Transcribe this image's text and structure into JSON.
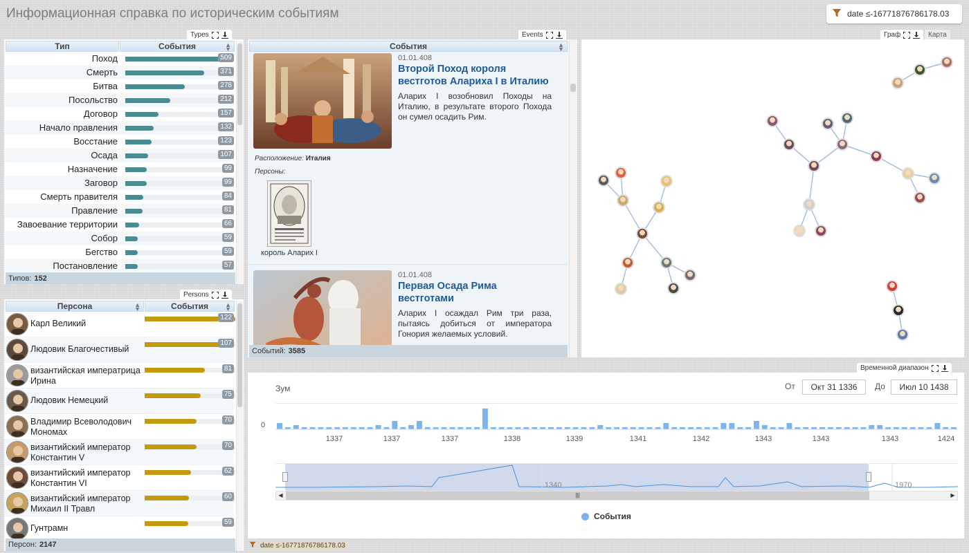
{
  "page": {
    "title": "Информационная справка по историческим событиям"
  },
  "filter": {
    "text": "date ≤-16771876786178.03",
    "icon": "funnel-icon"
  },
  "types_panel": {
    "tab": "Types",
    "col_type": "Тип",
    "col_events": "События",
    "bar_color": "#4a8a93",
    "rows": [
      {
        "label": "Поход",
        "count": "509",
        "value": 509
      },
      {
        "label": "Смерть",
        "count": "371",
        "value": 371
      },
      {
        "label": "Битва",
        "count": "278",
        "value": 278
      },
      {
        "label": "Посольство",
        "count": "212",
        "value": 212
      },
      {
        "label": "Договор",
        "count": "157",
        "value": 157
      },
      {
        "label": "Начало правления",
        "count": "132",
        "value": 132
      },
      {
        "label": "Восстание",
        "count": "123",
        "value": 123
      },
      {
        "label": "Осада",
        "count": "107",
        "value": 107
      },
      {
        "label": "Назначение",
        "count": "99",
        "value": 99
      },
      {
        "label": "Заговор",
        "count": "99",
        "value": 99
      },
      {
        "label": "Смерть правителя",
        "count": "84",
        "value": 84
      },
      {
        "label": "Правление",
        "count": "81",
        "value": 81
      },
      {
        "label": "Завоевание территории",
        "count": "66",
        "value": 66
      },
      {
        "label": "Собор",
        "count": "59",
        "value": 59
      },
      {
        "label": "Бегство",
        "count": "59",
        "value": 59
      },
      {
        "label": "Постановление",
        "count": "57",
        "value": 57
      }
    ],
    "footer_label": "Типов:",
    "footer_count": "152"
  },
  "persons_panel": {
    "tab": "Persons",
    "col_person": "Персона",
    "col_events": "События",
    "bar_color": "#c39a0e",
    "rows": [
      {
        "name": "Карл Великий",
        "count": "122",
        "value": 122
      },
      {
        "name": "Людовик Благочестивый",
        "count": "107",
        "value": 107
      },
      {
        "name": "византийская императрица Ирина",
        "count": "81",
        "value": 81
      },
      {
        "name": "Людовик Немецкий",
        "count": "75",
        "value": 75
      },
      {
        "name": "Владимир Всеволодович Мономах",
        "count": "70",
        "value": 70
      },
      {
        "name": "византийский император Константин V",
        "count": "70",
        "value": 70
      },
      {
        "name": "византийский император Константин VI",
        "count": "62",
        "value": 62
      },
      {
        "name": "византийский император Михаил II Травл",
        "count": "60",
        "value": 60
      },
      {
        "name": "Гунтрамн",
        "count": "59",
        "value": 59
      }
    ],
    "footer_label": "Персон:",
    "footer_count": "2147"
  },
  "events_panel": {
    "tab": "Events",
    "header": "События",
    "events": [
      {
        "date": "01.01.408",
        "title": "Второй Поход короля вестготов Алариха I в Италию",
        "desc": "Аларих I возобновил Походы на Италию, в результате второго Похода он сумел осадить Рим.",
        "location_label": "Расположение:",
        "location": "Италия",
        "persons_label": "Персоны:",
        "person_caption": "король Аларих I"
      },
      {
        "date": "01.01.408",
        "title": "Первая Осада Рима вестготами",
        "desc": "Аларих I осаждал Рим три раза, пытаясь добиться от императора Гонория желаемых условий."
      }
    ],
    "footer_label": "Событий:",
    "footer_count": "3585"
  },
  "graph_panel": {
    "tab_graph": "Граф",
    "tab_map": "Карта"
  },
  "timeline": {
    "tab": "Временной диапазон",
    "zoom_label": "Зум",
    "from_label": "От",
    "from_value": "Окт 31 1336",
    "to_label": "До",
    "to_value": "Июл 10 1438",
    "y_tick": "0",
    "x_ticks": [
      "1337",
      "1337",
      "1337",
      "1338",
      "1339",
      "1341",
      "1342",
      "1343",
      "1343",
      "1343",
      "1424"
    ],
    "navigator_labels": [
      "1340",
      "1970"
    ],
    "legend": "События",
    "series_color": "#7cb5ec",
    "bars": [
      3,
      1,
      2,
      1,
      1,
      1,
      1,
      1,
      1,
      1,
      1,
      1,
      2,
      1,
      4,
      1,
      2,
      4,
      1,
      1,
      1,
      1,
      1,
      1,
      1,
      10,
      1,
      1,
      1,
      1,
      1,
      1,
      1,
      1,
      1,
      1,
      1,
      1,
      1,
      2,
      1,
      1,
      1,
      1,
      1,
      1,
      1,
      3,
      1,
      1,
      1,
      1,
      1,
      1,
      3,
      3,
      1,
      1,
      4,
      2,
      1,
      1,
      3,
      1,
      1,
      1,
      1,
      1,
      1,
      1,
      1,
      1,
      2,
      2,
      1,
      1,
      1,
      1,
      1,
      1,
      3,
      1,
      1
    ]
  },
  "bottom_filter": {
    "text": "date ≤-16771876786178.03"
  }
}
